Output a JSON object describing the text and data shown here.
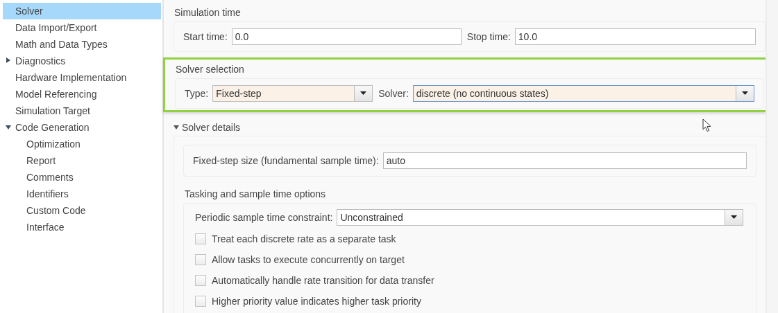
{
  "sidebar": {
    "items": [
      {
        "label": "Solver",
        "selected": true
      },
      {
        "label": "Data Import/Export",
        "selected": false
      },
      {
        "label": "Math and Data Types",
        "selected": false
      },
      {
        "label": "Diagnostics",
        "selected": false,
        "expanded": false
      },
      {
        "label": "Hardware Implementation",
        "selected": false
      },
      {
        "label": "Model Referencing",
        "selected": false
      },
      {
        "label": "Simulation Target",
        "selected": false
      },
      {
        "label": "Code Generation",
        "selected": false,
        "expanded": true,
        "children": [
          {
            "label": "Optimization",
            "selected": false
          },
          {
            "label": "Report",
            "selected": false
          },
          {
            "label": "Comments",
            "selected": false
          },
          {
            "label": "Identifiers",
            "selected": false
          },
          {
            "label": "Custom Code",
            "selected": false
          },
          {
            "label": "Interface",
            "selected": false
          }
        ]
      }
    ]
  },
  "simulation_time": {
    "title": "Simulation time",
    "start_label": "Start time:",
    "start_value": "0.0",
    "stop_label": "Stop time:",
    "stop_value": "10.0"
  },
  "solver_selection": {
    "title": "Solver selection",
    "highlighted": true,
    "type_label": "Type:",
    "type": {
      "value": "Fixed-step",
      "modified": true,
      "focused": false
    },
    "solver_label": "Solver:",
    "solver": {
      "value": "discrete (no continuous states)",
      "modified": true,
      "focused": true
    }
  },
  "solver_details": {
    "title": "Solver details",
    "expanded": true,
    "step_label": "Fixed-step size (fundamental sample time):",
    "step_value": "auto",
    "tasking": {
      "title": "Tasking and sample time options",
      "constraint_label": "Periodic sample time constraint:",
      "constraint": {
        "value": "Unconstrained",
        "modified": false,
        "focused": false
      },
      "options": [
        {
          "label": "Treat each discrete rate as a separate task",
          "checked": false
        },
        {
          "label": "Allow tasks to execute concurrently on target",
          "checked": false
        },
        {
          "label": "Automatically handle rate transition for data transfer",
          "checked": false
        },
        {
          "label": "Higher priority value indicates higher task priority",
          "checked": false
        }
      ]
    }
  }
}
